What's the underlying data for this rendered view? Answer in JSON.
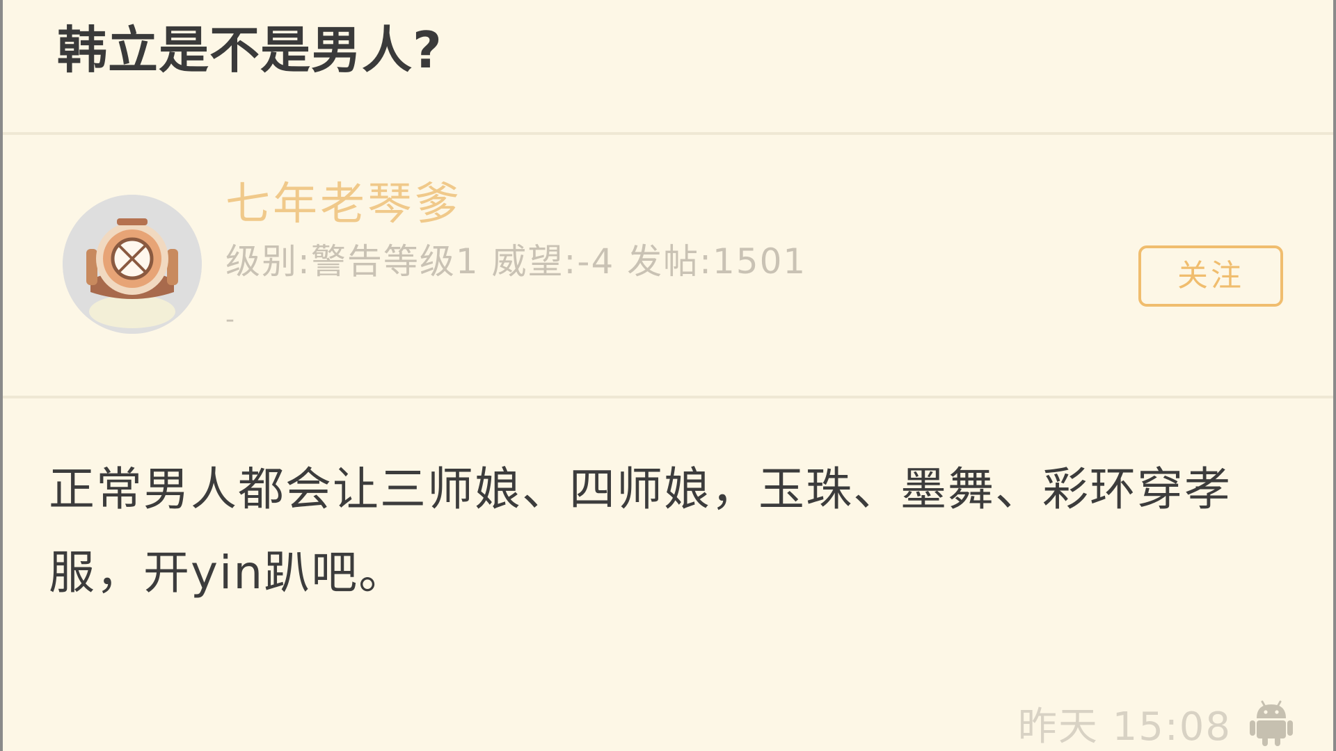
{
  "post": {
    "title": "韩立是不是男人?",
    "body": "正常男人都会让三师娘、四师娘，玉珠、墨舞、彩环穿孝服，开yin趴吧。",
    "time": "昨天 15:08",
    "client_icon": "android-icon"
  },
  "author": {
    "name": "七年老琴爹",
    "meta": "级别:警告等级1 威望:-4 发帖:1501",
    "signature": "-",
    "avatar_icon": "diving-helmet-avatar",
    "follow_label": "关注"
  },
  "colors": {
    "background": "#fdf7e6",
    "author_name": "#f0c98a",
    "accent": "#f0bd6e",
    "body_text": "#3c3c3c",
    "meta_text": "#c9c2b4"
  }
}
